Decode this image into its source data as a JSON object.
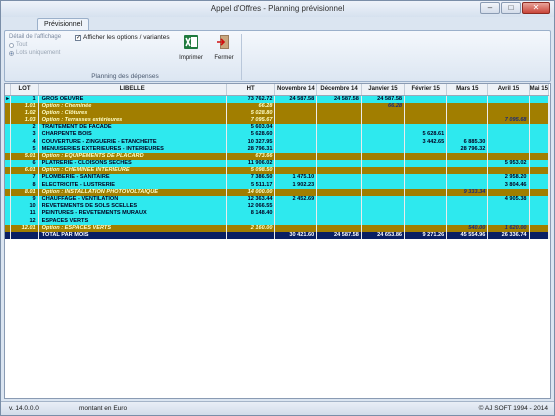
{
  "window": {
    "title": "Appel d'Offres - Planning prévisionnel",
    "btn_min": "–",
    "btn_max": "□",
    "btn_close": "✕"
  },
  "ribbon": {
    "tab": "Prévisionnel",
    "detail_label": "Détail de l'affichage",
    "radio1": "Tout",
    "radio2": "Lots uniquement",
    "check_label": "Afficher les options / variantes",
    "print_label": "Imprimer",
    "close_label": "Fermer",
    "group_label": "Planning des dépenses"
  },
  "grid": {
    "headers": [
      "LOT",
      "LIBELLE",
      "HT",
      "Novembre 14",
      "Décembre 14",
      "Janvier 15",
      "Février 15",
      "Mars 15",
      "Avril 15",
      "Mai 15"
    ],
    "rows": [
      {
        "t": "c",
        "lot": "1",
        "lib": "GROS OEUVRE",
        "v": [
          "73 762.72",
          "24 587.58",
          "24 587.58",
          "24 587.58",
          "",
          "",
          "",
          ""
        ]
      },
      {
        "t": "o",
        "lot": "1.01",
        "lib": "Option : Cheminée",
        "v": [
          "66.28",
          "",
          "",
          "66.28",
          "",
          "",
          "",
          ""
        ]
      },
      {
        "t": "o",
        "lot": "1.02",
        "lib": "Option : Clôtures",
        "v": [
          "5 028.80",
          "",
          "",
          "",
          "",
          "",
          "",
          ""
        ]
      },
      {
        "t": "o",
        "lot": "1.03",
        "lib": "Option : Terrasses extérieures",
        "v": [
          "7 095.67",
          "",
          "",
          "",
          "",
          "",
          "7 095.68",
          ""
        ]
      },
      {
        "t": "c",
        "lot": "2",
        "lib": "TRAITEMENT DE FACADE",
        "v": [
          "5 603.04",
          "",
          "",
          "",
          "",
          "",
          "",
          ""
        ]
      },
      {
        "t": "c",
        "lot": "3",
        "lib": "CHARPENTE BOIS",
        "v": [
          "5 628.60",
          "",
          "",
          "",
          "5 628.61",
          "",
          "",
          ""
        ]
      },
      {
        "t": "c",
        "lot": "4",
        "lib": "COUVERTURE - ZINGUERIE - ETANCHEITE",
        "v": [
          "10 327.95",
          "",
          "",
          "",
          "3 442.65",
          "6 885.30",
          "",
          ""
        ]
      },
      {
        "t": "c",
        "lot": "5",
        "lib": "MENUISERIES EXTERIEURES - INTERIEURES",
        "v": [
          "28 796.31",
          "",
          "",
          "",
          "",
          "28 796.32",
          "",
          ""
        ]
      },
      {
        "t": "o",
        "lot": "5.01",
        "lib": "Option : EQUIPEMENTS DE PLACARD",
        "v": [
          "673.66",
          "",
          "",
          "",
          "",
          "",
          "",
          ""
        ]
      },
      {
        "t": "c",
        "lot": "6",
        "lib": "PLATRERIE - CLOISONS SECHES",
        "v": [
          "11 906.02",
          "",
          "",
          "",
          "",
          "",
          "5 953.02",
          ""
        ]
      },
      {
        "t": "o",
        "lot": "6.01",
        "lib": "Option : CHEMINEE INTERIEURE",
        "v": [
          "5 098.50",
          "",
          "",
          "",
          "",
          "",
          "",
          ""
        ]
      },
      {
        "t": "c",
        "lot": "7",
        "lib": "PLOMBERIE - SANITAIRE",
        "v": [
          "7 386.50",
          "1 475.10",
          "",
          "",
          "",
          "",
          "2 958.20",
          ""
        ]
      },
      {
        "t": "c",
        "lot": "8",
        "lib": "ELECTRICITE - LUSTRERIE",
        "v": [
          "5 511.17",
          "1 902.23",
          "",
          "",
          "",
          "",
          "3 804.46",
          ""
        ]
      },
      {
        "t": "o",
        "lot": "8.01",
        "lib": "Option : INSTALLATION PHOTOVOLTAIQUE",
        "v": [
          "14 000.00",
          "",
          "",
          "",
          "",
          "9 333.34",
          "",
          ""
        ]
      },
      {
        "t": "c",
        "lot": "9",
        "lib": "CHAUFFAGE - VENTILATION",
        "v": [
          "12 363.44",
          "2 452.69",
          "",
          "",
          "",
          "",
          "4 905.38",
          ""
        ]
      },
      {
        "t": "c",
        "lot": "10",
        "lib": "REVETEMENTS DE SOLS SCELLES",
        "v": [
          "12 066.55",
          "",
          "",
          "",
          "",
          "",
          "",
          ""
        ]
      },
      {
        "t": "c",
        "lot": "11",
        "lib": "PEINTURES - REVETEMENTS MURAUX",
        "v": [
          "8 148.40",
          "",
          "",
          "",
          "",
          "",
          "",
          ""
        ]
      },
      {
        "t": "c",
        "lot": "12",
        "lib": "ESPACES VERTS",
        "v": [
          "",
          "",
          "",
          "",
          "",
          "",
          "",
          ""
        ]
      },
      {
        "t": "o",
        "lot": "12.01",
        "lib": "Option : ESPACES VERTS",
        "v": [
          "2 160.00",
          "",
          "",
          "",
          "",
          "540.00",
          "1 620.00",
          ""
        ]
      },
      {
        "t": "t",
        "lot": "",
        "lib": "TOTAL PAR MOIS",
        "v": [
          "",
          "30 421.60",
          "24 587.58",
          "24 653.86",
          "9 271.26",
          "45 554.96",
          "26 336.74",
          ""
        ]
      }
    ]
  },
  "status": {
    "version": "v. 14.0.0.0",
    "currency": "montant en  Euro",
    "copyright": "© AJ SOFT 1994 - 2014"
  }
}
